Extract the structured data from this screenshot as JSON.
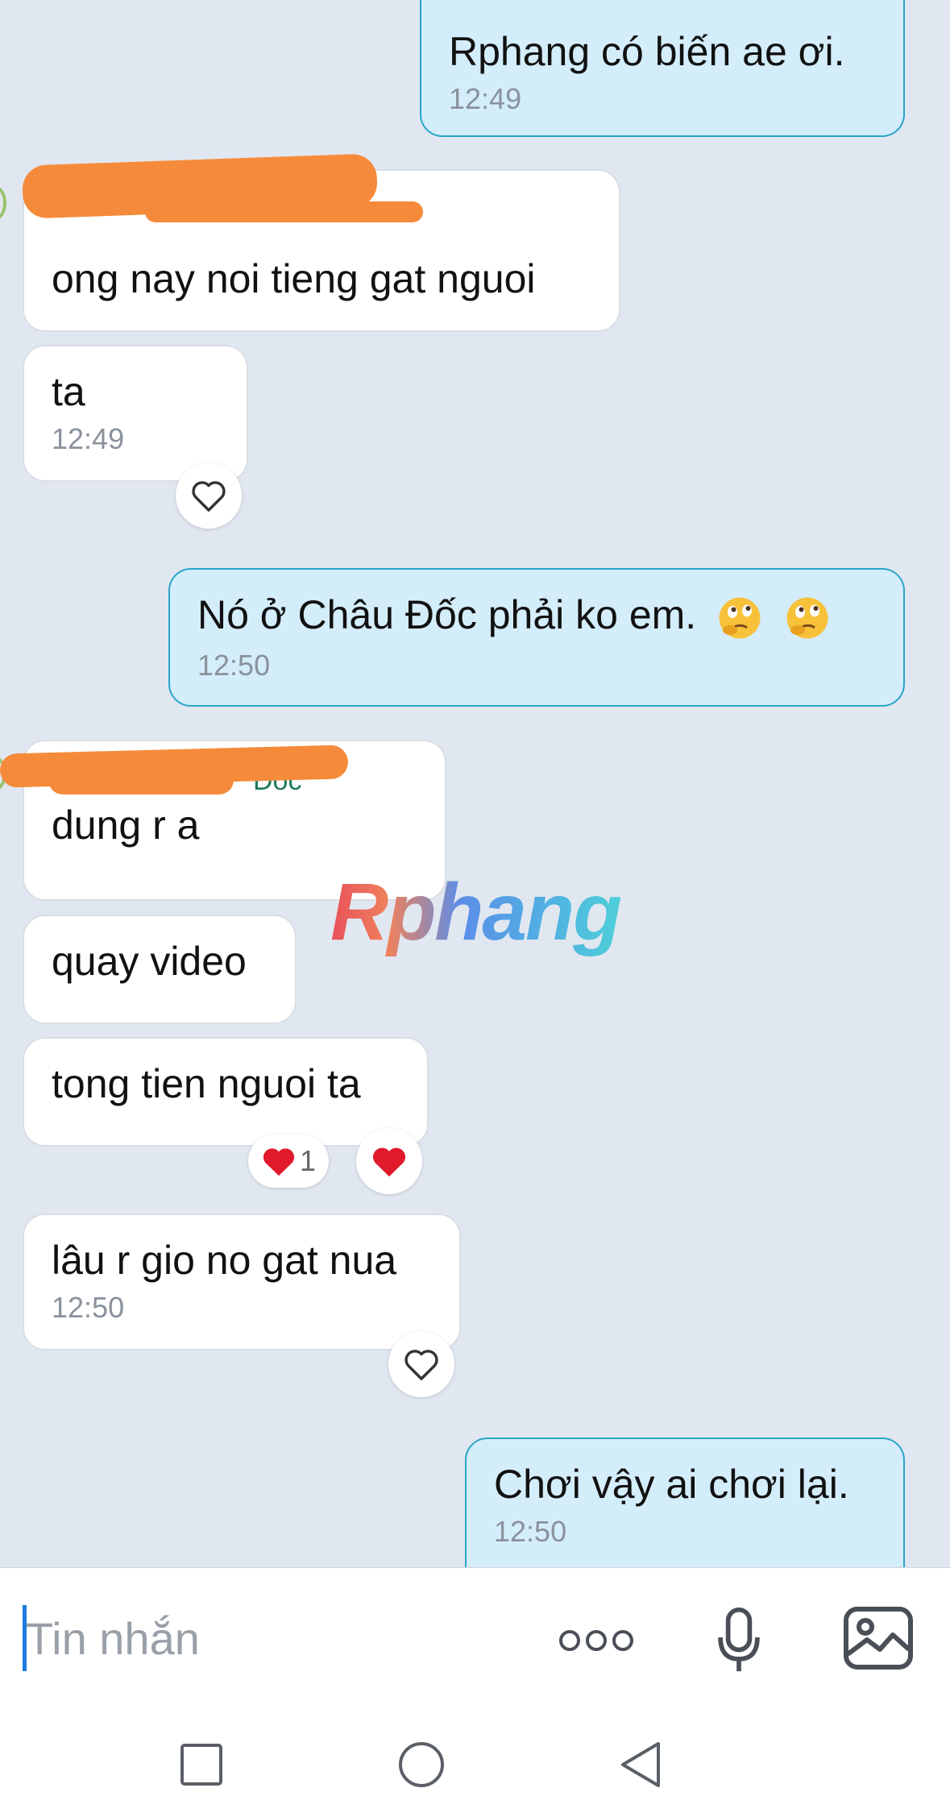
{
  "messages": [
    {
      "text": "Rphang có biến ae ơi.",
      "time": "12:49"
    },
    {
      "text": "ong nay noi tieng gat nguoi"
    },
    {
      "text": "ta",
      "time": "12:49"
    },
    {
      "text": "Nó ở Châu Đốc phải ko em.",
      "time": "12:50"
    },
    {
      "sender": "Đốc",
      "text": "dung r a"
    },
    {
      "text": "quay video"
    },
    {
      "text": "tong tien nguoi ta",
      "reaction_count": "1"
    },
    {
      "text": "lâu r gio no gat nua",
      "time": "12:50"
    },
    {
      "text": "Chơi vậy ai chơi lại.",
      "time": "12:50"
    }
  ],
  "watermark": "Rphang",
  "composer": {
    "placeholder": "Tin nhắn"
  },
  "icons": {
    "like": "heart-outline-icon",
    "reaction": "red-heart-icon",
    "emoji": "thinking-face-emoji",
    "more": "more-dots-icon",
    "mic": "microphone-icon",
    "image": "image-icon",
    "nav": [
      "recent-apps-icon",
      "home-icon",
      "back-icon"
    ]
  },
  "colors": {
    "accent": "#1c7ce0",
    "out_bubble": "#d4edfb",
    "out_border": "#2aa5c9",
    "redaction": "#f58b3a"
  }
}
